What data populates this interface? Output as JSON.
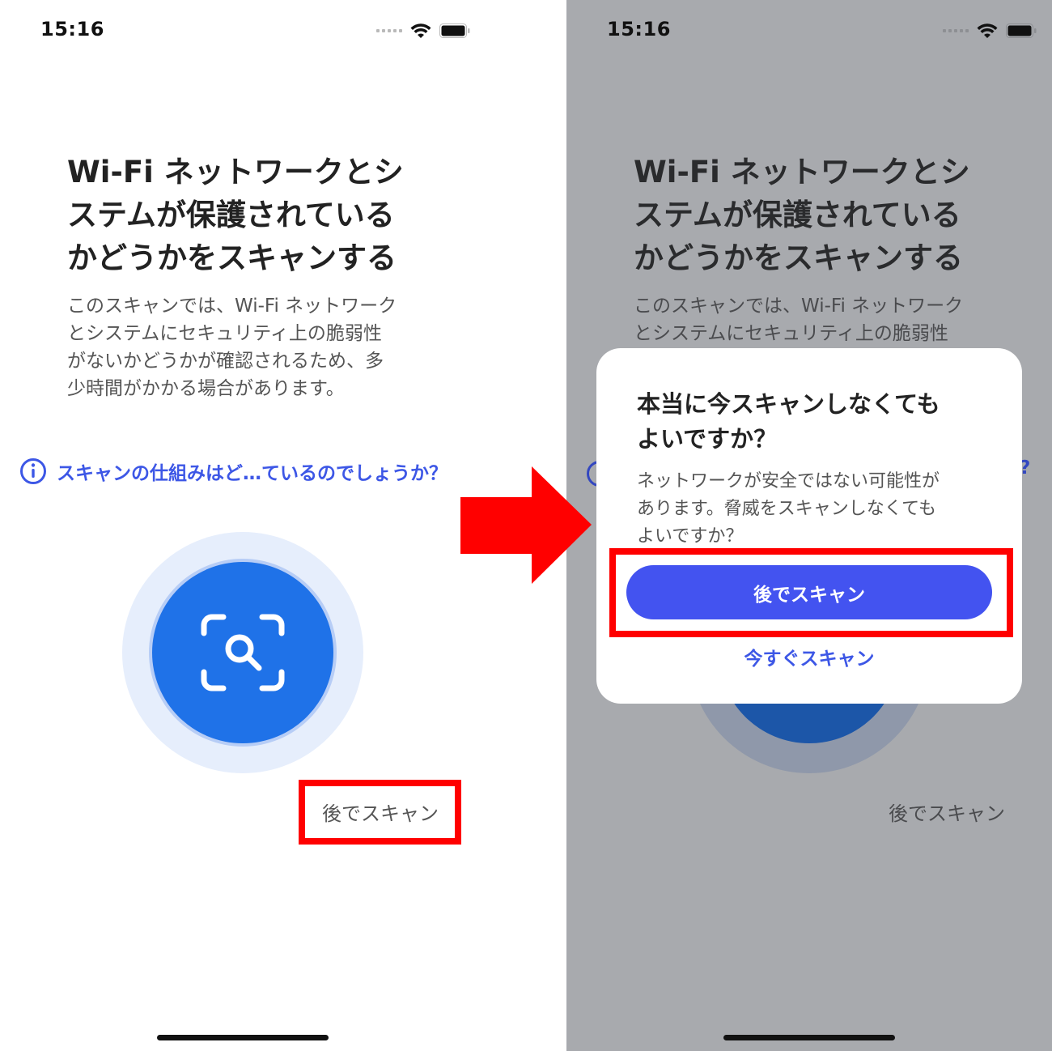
{
  "left": {
    "status": {
      "time": "15:16"
    },
    "title_lines": [
      "Wi-Fi ネットワークとシ",
      "ステムが保護されている",
      "かどうかをスキャンする"
    ],
    "body_lines": [
      "このスキャンでは、Wi-Fi ネットワーク",
      "とシステムにセキュリティ上の脆弱性",
      "がないかどうかが確認されるため、多",
      "少時間がかかる場合があります。"
    ],
    "info_link": "スキャンの仕組みはど…ているのでしょうか？",
    "scan_later": "後でスキャン",
    "icons": {
      "info": "info-icon",
      "scan": "scan-search-icon"
    }
  },
  "right": {
    "status": {
      "time": "15:16"
    },
    "title_lines": [
      "Wi-Fi ネットワークとシ",
      "ステムが保護されている",
      "かどうかをスキャンする"
    ],
    "body_lines": [
      "このスキャンでは、Wi-Fi ネットワーク",
      "とシステムにセキュリティ上の脆弱性"
    ],
    "scan_later": "後でスキャン",
    "dialog": {
      "title_lines": [
        "本当に今スキャンしなくても",
        "よいですか？"
      ],
      "body_lines": [
        "ネットワークが安全ではない可能性が",
        "あります。脅威をスキャンしなくても",
        "よいですか？"
      ],
      "primary_button": "後でスキャン",
      "secondary_link": "今すぐスキャン"
    }
  },
  "colors": {
    "accent_blue": "#3d57e6",
    "scan_button": "#1f72e8",
    "primary_button": "#4353f0",
    "highlight_red": "#ff0000",
    "overlay_gray": "#a8aaae"
  }
}
